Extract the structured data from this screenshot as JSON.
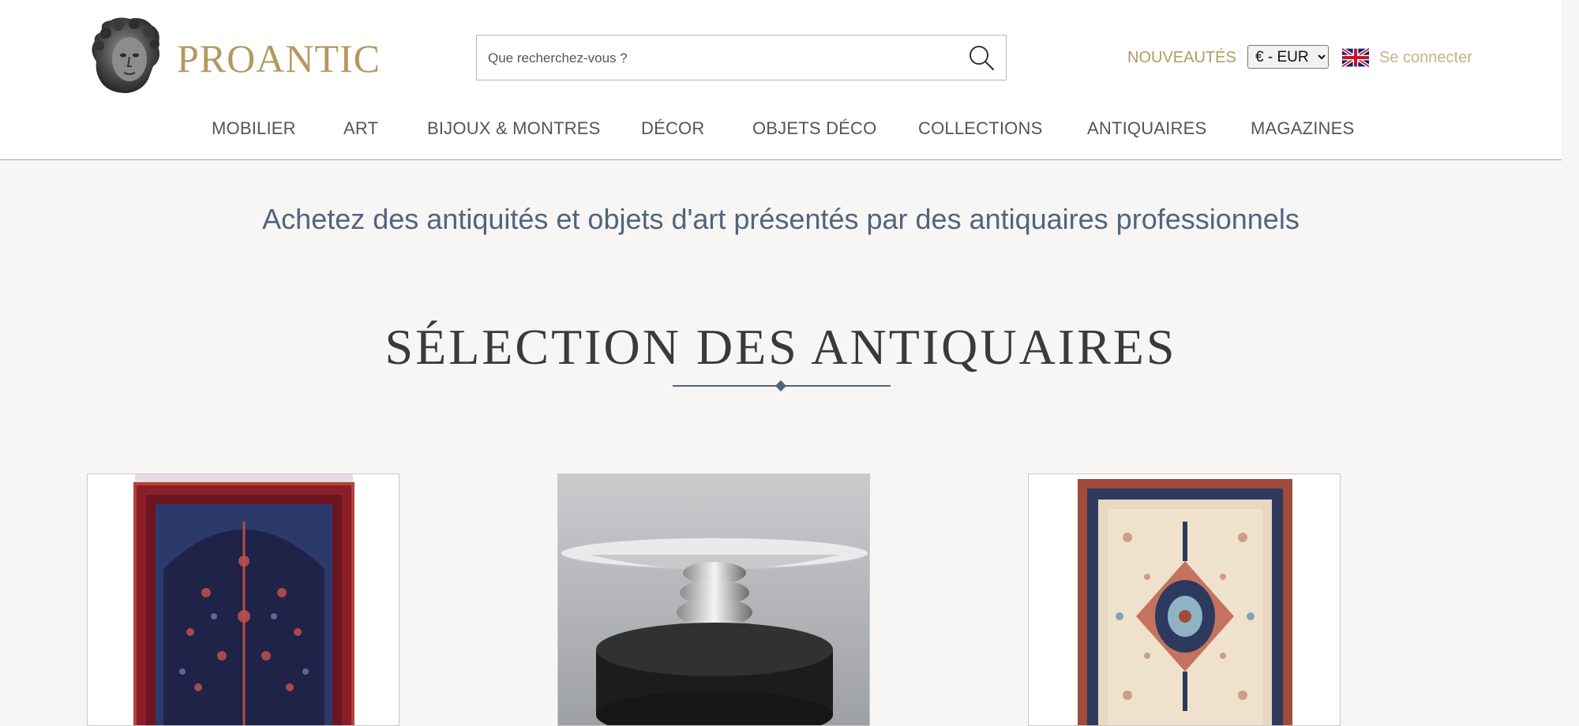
{
  "header": {
    "logo_text": "PROANTIC",
    "search": {
      "placeholder": "Que recherchez-vous ?",
      "value": ""
    },
    "nouveautes_label": "NOUVEAUTÉS",
    "currency": {
      "selected": "€ - EUR",
      "options": [
        "€ - EUR"
      ]
    },
    "login_label": "Se connecter",
    "colors": {
      "accent": "#b5985e",
      "login": "#c9b185",
      "nav_text": "#555555"
    }
  },
  "nav": {
    "items": [
      {
        "label": "MOBILIER"
      },
      {
        "label": "ART"
      },
      {
        "label": "BIJOUX & MONTRES"
      },
      {
        "label": "DÉCOR"
      },
      {
        "label": "OBJETS DÉCO"
      },
      {
        "label": "COLLECTIONS"
      },
      {
        "label": "ANTIQUAIRES"
      },
      {
        "label": "MAGAZINES"
      }
    ]
  },
  "main": {
    "tagline": "Achetez des antiquités et objets d'art présentés par des antiquaires professionnels",
    "section_title": "SÉLECTION DES ANTIQUAIRES",
    "products": [
      {
        "image": "red-prayer-rug-image"
      },
      {
        "image": "silver-centerpiece-image"
      },
      {
        "image": "light-medallion-rug-image"
      }
    ],
    "colors": {
      "tagline": "#51647d",
      "background": "#f7f6f4"
    }
  }
}
